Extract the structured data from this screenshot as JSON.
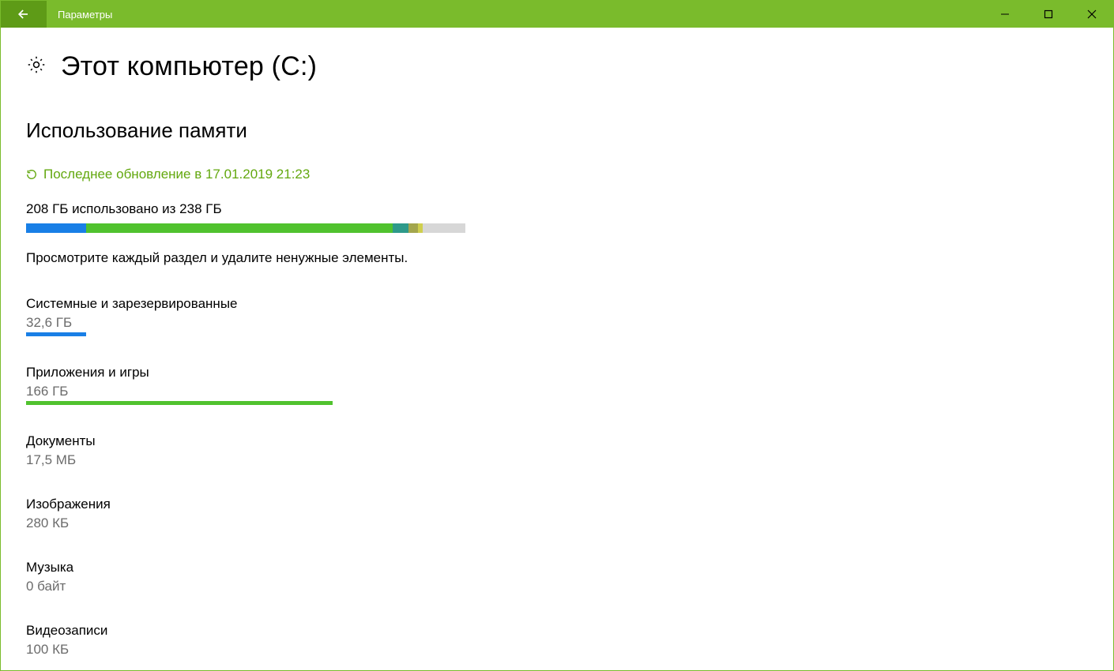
{
  "window": {
    "title": "Параметры"
  },
  "page": {
    "title": "Этот компьютер (C:)",
    "section_title": "Использование памяти",
    "refresh_label": "Последнее обновление в 17.01.2019 21:23",
    "usage_summary": "208 ГБ использовано из 238 ГБ",
    "hint": "Просмотрите каждый раздел и удалите ненужные элементы."
  },
  "categories": [
    {
      "name": "Системные и зарезервированные",
      "size": "32,6 ГБ",
      "bar": "blue"
    },
    {
      "name": "Приложения и игры",
      "size": "166 ГБ",
      "bar": "green"
    },
    {
      "name": "Документы",
      "size": "17,5 МБ",
      "bar": ""
    },
    {
      "name": "Изображения",
      "size": "280 КБ",
      "bar": ""
    },
    {
      "name": "Музыка",
      "size": "0 байт",
      "bar": ""
    },
    {
      "name": "Видеозаписи",
      "size": "100 КБ",
      "bar": ""
    }
  ],
  "colors": {
    "accent": "#7abb2c",
    "accent_dark": "#5e9b17",
    "blue": "#197fe6",
    "green": "#50c22e"
  }
}
